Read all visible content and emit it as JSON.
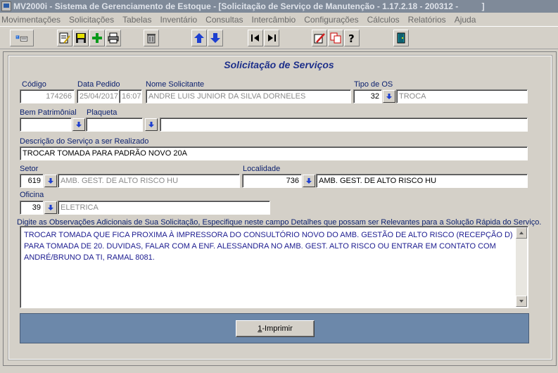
{
  "window": {
    "title": "MV2000i - Sistema de Gerenciamento de Estoque - [Solicitação de Serviço de Manutenção - 1.17.2.18 - 200312 -          ]"
  },
  "menu": [
    "Movimentações",
    "Solicitações",
    "Tabelas",
    "Inventário",
    "Consultas",
    "Intercâmbio",
    "Configurações",
    "Cálculos",
    "Relatórios",
    "Ajuda"
  ],
  "toolbar": {
    "icons": [
      "query-icon",
      "edit-icon",
      "save-icon",
      "add-icon",
      "print-icon",
      "delete-icon",
      "arrow-up-icon",
      "arrow-down-icon",
      "first-record-icon",
      "last-record-icon",
      "pencil-icon",
      "copy-icon",
      "help-icon",
      "exit-door-icon"
    ]
  },
  "form": {
    "title": "Solicitação de Serviços",
    "labels": {
      "codigo": "Código",
      "data_pedido": "Data Pedido",
      "nome_solicitante": "Nome Solicitante",
      "tipo_os": "Tipo de OS",
      "bem_patrimonial": "Bem Patrimônial",
      "plaqueta": "Plaqueta",
      "descricao": "Descrição do Serviço a ser Realizado",
      "setor": "Setor",
      "localidade": "Localidade",
      "oficina": "Oficina",
      "observacoes_hint": "Digite as Observações Adicionais de Sua Solicitação, Especifique neste campo Detalhes que possam ser Relevantes para a Solução Rápida do Serviço."
    },
    "values": {
      "codigo": "174266",
      "data": "25/04/2017",
      "hora": "16:07",
      "nome_solicitante": "ANDRE LUIS JUNIOR DA SILVA DORNELES",
      "tipo_os_code": "32",
      "tipo_os_desc": "TROCA",
      "bem_patrimonial": "",
      "plaqueta": "",
      "plaqueta_desc": "",
      "descricao": "TROCAR TOMADA PARA PADRÃO NOVO 20A",
      "setor_code": "619",
      "setor_desc": "AMB. GEST. DE ALTO RISCO HU",
      "localidade_code": "736",
      "localidade_desc": "AMB. GEST. DE ALTO RISCO HU",
      "oficina_code": "39",
      "oficina_desc": "ELETRICA",
      "observacoes": "TROCAR TOMADA QUE FICA PROXIMA À IMPRESSORA DO CONSULTÓRIO NOVO DO AMB. GESTÃO DE ALTO RISCO (RECEPÇÃO D) PARA TOMADA DE 20. DUVIDAS, FALAR COM A ENF. ALESSANDRA NO AMB. GEST. ALTO RISCO OU ENTRAR EM CONTATO COM ANDRÉ/BRUNO DA TI, RAMAL 8081."
    },
    "print_button": {
      "accel": "1",
      "label": "-Imprimir"
    }
  }
}
